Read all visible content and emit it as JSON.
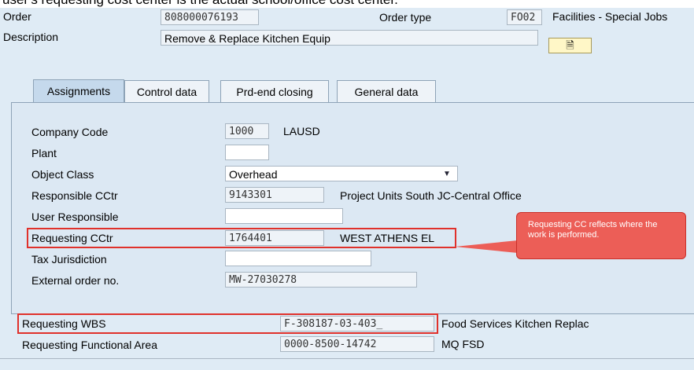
{
  "caption": "user's requesting cost center is the actual school/office cost center.",
  "header": {
    "order_label": "Order",
    "order_value": "808000076193",
    "order_type_label": "Order type",
    "order_type_value": "FO02",
    "order_type_desc": "Facilities - Special Jobs",
    "description_label": "Description",
    "description_value": "Remove & Replace Kitchen Equip",
    "longtext_icon": "document-edit-icon"
  },
  "tabs": [
    "Assignments",
    "Control data",
    "Prd-end closing",
    "General data"
  ],
  "fields": {
    "company_code": {
      "label": "Company Code",
      "value": "1000",
      "desc": "LAUSD"
    },
    "plant": {
      "label": "Plant",
      "value": ""
    },
    "object_class": {
      "label": "Object Class",
      "value": "Overhead"
    },
    "responsible_cctr": {
      "label": "Responsible CCtr",
      "value": "9143301",
      "desc": "Project Units South JC-Central Office"
    },
    "user_responsible": {
      "label": "User Responsible",
      "value": ""
    },
    "requesting_cctr": {
      "label": "Requesting CCtr",
      "value": "1764401",
      "desc": "WEST ATHENS EL"
    },
    "tax_jurisdiction": {
      "label": "Tax Jurisdiction",
      "value": ""
    },
    "external_order": {
      "label": "External order no.",
      "value": "MW-27030278"
    }
  },
  "lower": {
    "requesting_wbs": {
      "label": "Requesting WBS",
      "value": "F-308187-03-403_",
      "desc": "Food Services Kitchen Replac"
    },
    "requesting_fa": {
      "label": "Requesting Functional Area",
      "value": "0000-8500-14742",
      "desc": "MQ FSD"
    }
  },
  "callout": {
    "text": "Requesting CC reflects where the work is performed."
  },
  "colors": {
    "highlight": "#e0312b",
    "callout_fill": "#ec5e57"
  }
}
